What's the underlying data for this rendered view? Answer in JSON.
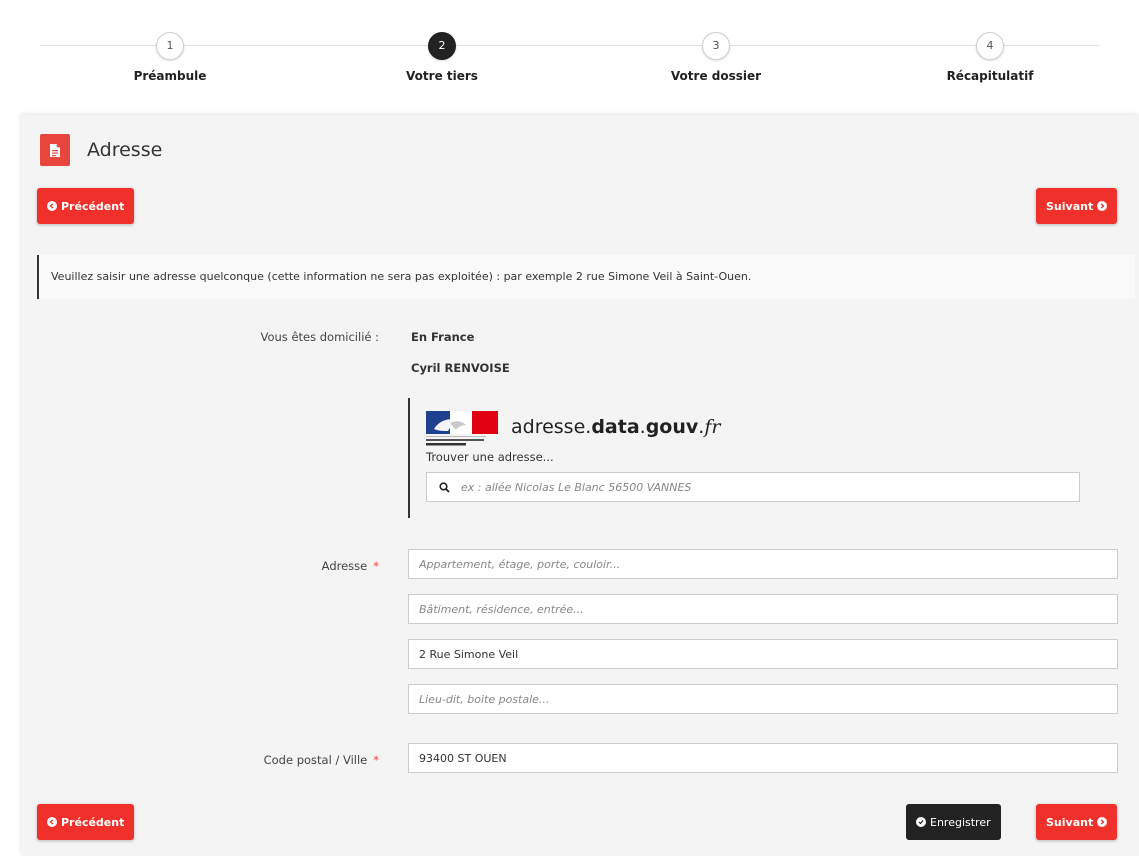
{
  "stepper": {
    "steps": [
      {
        "number": "1",
        "label": "Préambule"
      },
      {
        "number": "2",
        "label": "Votre tiers"
      },
      {
        "number": "3",
        "label": "Votre dossier"
      },
      {
        "number": "4",
        "label": "Récapitulatif"
      }
    ],
    "active_step": 2
  },
  "page": {
    "title": "Adresse",
    "title_icon": "document-icon"
  },
  "nav": {
    "previous_label": "Précédent",
    "next_label": "Suivant",
    "save_label": "Enregistrer"
  },
  "info_message": "Veuillez saisir une adresse quelconque (cette information ne sera pas exploitée) : par exemple 2 rue Simone Veil à Saint-Ouen.",
  "form": {
    "domicile_label": "Vous êtes domicilié :",
    "domicile_value": "En France",
    "person_name": "Cyril RENVOISE",
    "ban": {
      "brand_prefix": "adresse.",
      "brand_bold": "data",
      "brand_mid": ".",
      "brand_bold2": "gouv",
      "brand_dot": ".",
      "brand_suffix": "fr",
      "hint": "Trouver une adresse...",
      "search_placeholder": "ex : allée Nicolas Le Blanc 56500 VANNES",
      "search_value": ""
    },
    "address_label": "Adresse",
    "required_mark": "*",
    "address_lines": [
      {
        "placeholder": "Appartement, étage, porte, couloir...",
        "value": ""
      },
      {
        "placeholder": "Bâtiment, résidence, entrée...",
        "value": ""
      },
      {
        "placeholder": "",
        "value": "2 Rue Simone Veil"
      },
      {
        "placeholder": "Lieu-dit, boite postale...",
        "value": ""
      }
    ],
    "postal_label": "Code postal / Ville",
    "postal_value": "93400 ST OUEN"
  },
  "colors": {
    "accent_red": "#f0312b",
    "dark": "#222222"
  }
}
